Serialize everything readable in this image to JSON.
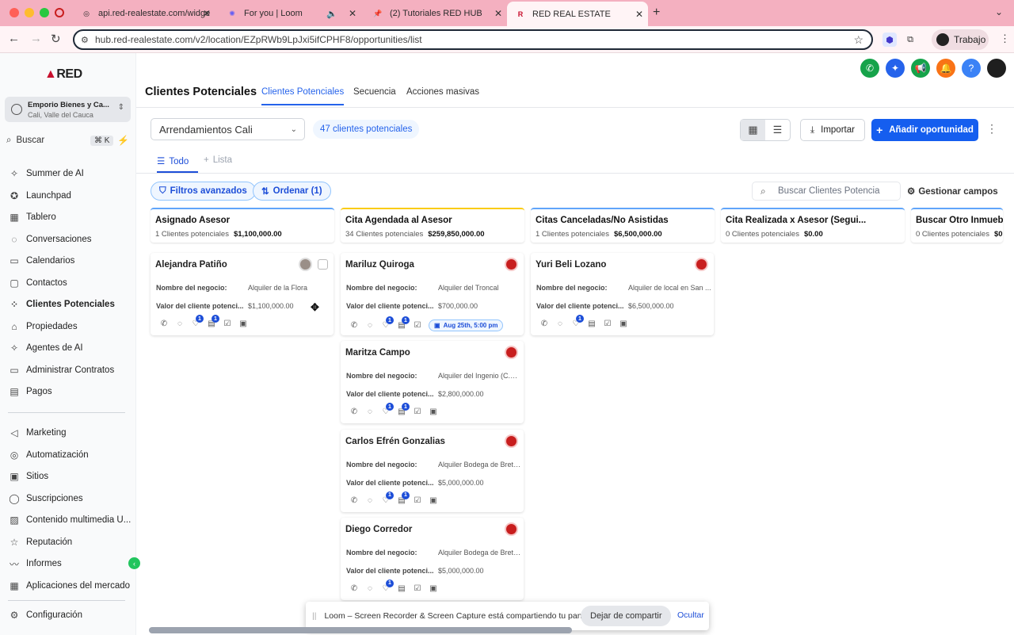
{
  "browser": {
    "tabs": [
      {
        "label": "api.red-realestate.com/widge",
        "icon": "globe-icon"
      },
      {
        "label": "For you | Loom",
        "icon": "loom-icon"
      },
      {
        "label": "(2) Tutoriales RED HUB",
        "icon": "pin-icon"
      },
      {
        "label": "RED REAL ESTATE",
        "icon": "red-logo-icon"
      }
    ],
    "url": "hub.red-realestate.com/v2/location/EZpRWb9LpJxi5ifCPHF8/opportunities/list",
    "profile_label": "Trabajo"
  },
  "sidebar": {
    "logo": "RED",
    "account_name": "Emporio Bienes y Ca...",
    "account_location": "Cali, Valle del Cauca",
    "search_label": "Buscar",
    "search_shortcut": "⌘ K",
    "items": [
      {
        "label": "Summer de AI",
        "icon": "sparkle-icon"
      },
      {
        "label": "Launchpad",
        "icon": "rocket-icon"
      },
      {
        "label": "Tablero",
        "icon": "dashboard-icon"
      },
      {
        "label": "Conversaciones",
        "icon": "chat-icon"
      },
      {
        "label": "Calendarios",
        "icon": "calendar-icon"
      },
      {
        "label": "Contactos",
        "icon": "contacts-icon"
      },
      {
        "label": "Clientes Potenciales",
        "icon": "opportunities-icon"
      },
      {
        "label": "Propiedades",
        "icon": "home-icon"
      },
      {
        "label": "Agentes de AI",
        "icon": "ai-agent-icon"
      },
      {
        "label": "Administrar Contratos",
        "icon": "folder-icon"
      },
      {
        "label": "Pagos",
        "icon": "payments-icon"
      }
    ],
    "items2": [
      {
        "label": "Marketing",
        "icon": "megaphone-icon"
      },
      {
        "label": "Automatización",
        "icon": "automation-icon"
      },
      {
        "label": "Sitios",
        "icon": "sites-icon"
      },
      {
        "label": "Suscripciones",
        "icon": "subscriptions-icon"
      },
      {
        "label": "Contenido multimedia U...",
        "icon": "media-icon"
      },
      {
        "label": "Reputación",
        "icon": "star-icon"
      },
      {
        "label": "Informes",
        "icon": "reports-icon"
      },
      {
        "label": "Aplicaciones del mercado",
        "icon": "apps-icon"
      }
    ],
    "settings_label": "Configuración"
  },
  "header": {
    "title": "Clientes Potenciales",
    "tabs": [
      "Clientes Potenciales",
      "Secuencia",
      "Acciones masivas"
    ]
  },
  "toolbar": {
    "pipeline": "Arrendamientos Cali",
    "count": "47 clientes potenciales",
    "import_label": "Importar",
    "add_label": "Añadir oportunidad"
  },
  "subtabs": {
    "all": "Todo",
    "list": "Lista"
  },
  "filters": {
    "advanced": "Filtros avanzados",
    "sort": "Ordenar (1)",
    "search_placeholder": "Buscar Clientes Potencia",
    "manage_fields": "Gestionar campos"
  },
  "field_labels": {
    "business": "Nombre del negocio:",
    "value": "Valor del cliente potenci..."
  },
  "columns": [
    {
      "title": "Asignado Asesor",
      "count": "1 Clientes potenciales",
      "amount": "$1,100,000.00",
      "color": "#60a5fa",
      "cards": [
        {
          "name": "Alejandra Patiño",
          "business": "Alquiler de la Flora",
          "value": "$1,100,000.00",
          "badges": [
            null,
            null,
            "1",
            "1",
            null,
            null
          ]
        }
      ]
    },
    {
      "title": "Cita Agendada al Asesor",
      "count": "34 Clientes potenciales",
      "amount": "$259,850,000.00",
      "color": "#facc15",
      "cards": [
        {
          "name": "Mariluz Quiroga",
          "business": "Alquiler del Troncal",
          "value": "$700,000.00",
          "badges": [
            null,
            null,
            "1",
            "1",
            null
          ],
          "date": "Aug 25th, 5:00 pm"
        },
        {
          "name": "Maritza Campo",
          "business": "Alquiler del Ingenio (C.R...",
          "value": "$2,800,000.00",
          "badges": [
            null,
            null,
            "1",
            "1",
            null,
            null
          ]
        },
        {
          "name": "Carlos Efrén Gonzalias",
          "business": "Alquiler Bodega de Breta...",
          "value": "$5,000,000.00",
          "badges": [
            null,
            null,
            "1",
            "1",
            null,
            null
          ]
        },
        {
          "name": "Diego Corredor",
          "business": "Alquiler Bodega de Breta...",
          "value": "$5,000,000.00",
          "badges": [
            null,
            null,
            "1",
            null,
            null,
            null
          ]
        }
      ]
    },
    {
      "title": "Citas Canceladas/No Asistidas",
      "count": "1 Clientes potenciales",
      "amount": "$6,500,000.00",
      "color": "#60a5fa",
      "cards": [
        {
          "name": "Yuri Beli Lozano",
          "business": "Alquiler de local en San ...",
          "value": "$6,500,000.00",
          "badges": [
            null,
            null,
            "1",
            null,
            null,
            null
          ]
        }
      ]
    },
    {
      "title": "Cita Realizada x Asesor (Segui...",
      "count": "0 Clientes potenciales",
      "amount": "$0.00",
      "color": "#60a5fa",
      "cards": []
    },
    {
      "title": "Buscar Otro Inmueble",
      "count": "0 Clientes potenciales",
      "amount": "$0",
      "color": "#60a5fa",
      "cards": []
    }
  ],
  "loom": {
    "message": "Loom – Screen Recorder & Screen Capture está compartiendo tu pantalla.",
    "stop_label": "Dejar de compartir",
    "hide_label": "Ocultar"
  },
  "colors": {
    "primary": "#155eef",
    "accent_red": "#c8102e",
    "tabbar": "#f4b0c0"
  }
}
